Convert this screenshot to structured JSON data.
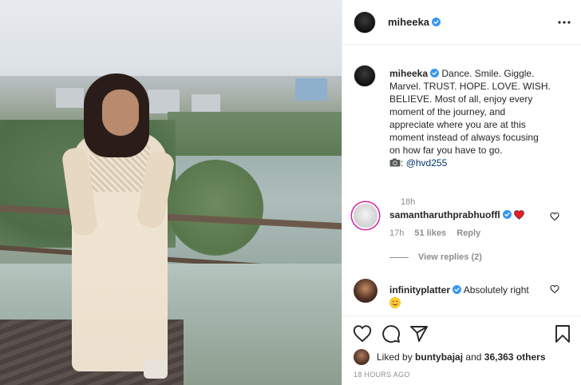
{
  "post": {
    "author": "miheeka",
    "caption_lines": [
      "Dance. Smile. Giggle.",
      "Marvel. TRUST. HOPE. LOVE. WISH.",
      "BELIEVE. Most of all, enjoy every",
      "moment of the journey, and",
      "appreciate where you are at this",
      "moment instead of always focusing",
      "on how far you have to go."
    ],
    "photo_credit_prefix": ":",
    "photo_credit_handle": "@hvd255",
    "caption_time": "18h",
    "timestamp": "18 HOURS AGO"
  },
  "comments": [
    {
      "username": "samantharuthprabhuoffl",
      "text": "",
      "time": "17h",
      "likes": "51 likes",
      "reply": "Reply",
      "view_replies": "View replies (2)"
    },
    {
      "username": "infinityplatter",
      "text": "Absolutely right"
    }
  ],
  "likes": {
    "prefix": "Liked by",
    "user": "buntybajaj",
    "conjunction": "and",
    "others": "36,363 others"
  },
  "icons": {
    "verified": "verified-badge-icon",
    "more": "more-options-icon",
    "like": "heart-outline-icon",
    "comment": "comment-bubble-icon",
    "share": "paper-plane-icon",
    "save": "bookmark-icon"
  },
  "colors": {
    "verified_blue": "#3897f0",
    "link_blue": "#00376b",
    "heart_red": "#ed4956",
    "muted_text": "#8e8e8e"
  }
}
